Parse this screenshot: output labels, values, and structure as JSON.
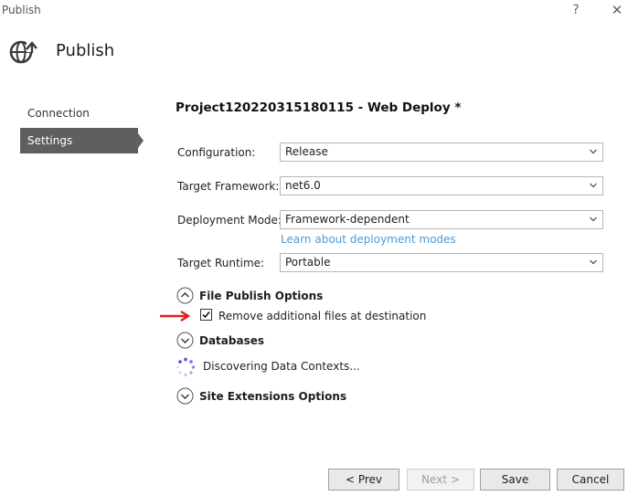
{
  "window": {
    "title": "Publish",
    "help_glyph": "?",
    "close_glyph": "✕"
  },
  "header": {
    "title": "Publish",
    "icon": "globe-arrow-icon"
  },
  "nav": {
    "items": [
      {
        "label": "Connection",
        "selected": false
      },
      {
        "label": "Settings",
        "selected": true
      }
    ]
  },
  "profile": {
    "title": "Project120220315180115 - Web Deploy *"
  },
  "settings": {
    "configuration": {
      "label": "Configuration:",
      "value": "Release"
    },
    "target_framework": {
      "label": "Target Framework:",
      "value": "net6.0"
    },
    "deployment_mode": {
      "label": "Deployment Mode:",
      "value": "Framework-dependent",
      "link": "Learn about deployment modes"
    },
    "target_runtime": {
      "label": "Target Runtime:",
      "value": "Portable"
    }
  },
  "sections": {
    "file_publish": {
      "label": "File Publish Options",
      "expanded": true
    },
    "remove_files": {
      "label": "Remove additional files at destination",
      "checked": true
    },
    "databases": {
      "label": "Databases",
      "expanded": false
    },
    "discovering": {
      "label": "Discovering Data Contexts..."
    },
    "site_extensions": {
      "label": "Site Extensions Options",
      "expanded": false
    }
  },
  "buttons": {
    "prev": "< Prev",
    "next": "Next >",
    "save": "Save",
    "cancel": "Cancel"
  },
  "colors": {
    "accent_link": "#4a9bd8",
    "nav_selected": "#5f5f5f",
    "annotation_arrow": "#e02020"
  }
}
